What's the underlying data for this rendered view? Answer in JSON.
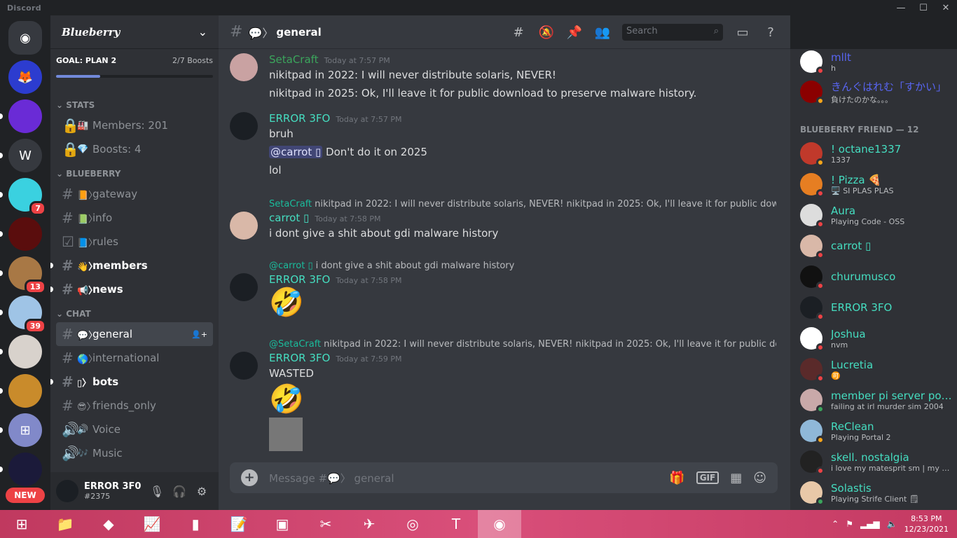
{
  "window": {
    "title": "Discord",
    "controls": [
      "—",
      "☐",
      "✕"
    ]
  },
  "guilds": {
    "items": [
      {
        "name": "home",
        "color": "#36393f",
        "glyph": "◉",
        "badge": ""
      },
      {
        "name": "firefox-server",
        "color": "#2c3ccf",
        "glyph": "🦊",
        "badge": ""
      },
      {
        "name": "purple-server",
        "color": "#6a2bd6",
        "glyph": "",
        "badge": ""
      },
      {
        "name": "w-server",
        "color": "#36393f",
        "glyph": "W",
        "badge": ""
      },
      {
        "name": "cloud-server",
        "color": "#3ad1e0",
        "glyph": "",
        "badge": "7"
      },
      {
        "name": "red-server",
        "color": "#5a0d0d",
        "glyph": "",
        "badge": ""
      },
      {
        "name": "dog-server",
        "color": "#a87845",
        "glyph": "",
        "badge": "13"
      },
      {
        "name": "anime-server",
        "color": "#9fc4e6",
        "glyph": "",
        "badge": "39"
      },
      {
        "name": "cat-server",
        "color": "#d8d2cc",
        "glyph": "",
        "badge": ""
      },
      {
        "name": "doge-server",
        "color": "#c98b2b",
        "glyph": "",
        "badge": ""
      },
      {
        "name": "windows-server",
        "color": "#8189c9",
        "glyph": "⊞",
        "badge": ""
      },
      {
        "name": "dark-server",
        "color": "#1b1a3a",
        "glyph": "",
        "badge": ""
      }
    ],
    "new_label": "NEW"
  },
  "server": {
    "name": "Blueberry",
    "goal": {
      "label": "GOAL: PLAN 2",
      "boosts": "2/7 Boosts",
      "progress": 0.28
    },
    "categories": [
      {
        "name": "STATS",
        "channels": [
          {
            "icon": "🔒",
            "emoji": "🏭",
            "label": "Members: 201",
            "state": "muted"
          },
          {
            "icon": "🔒",
            "emoji": "💎",
            "label": "Boosts: 4",
            "state": "muted"
          }
        ]
      },
      {
        "name": "BLUEBERRY",
        "channels": [
          {
            "icon": "#",
            "emoji": "📙〉",
            "label": "gateway",
            "state": "muted"
          },
          {
            "icon": "#",
            "emoji": "📗〉",
            "label": "info",
            "state": "muted"
          },
          {
            "icon": "☑",
            "emoji": "📘〉",
            "label": "rules",
            "state": "muted"
          },
          {
            "icon": "#",
            "emoji": "👋〉",
            "label": "members",
            "state": "unread"
          },
          {
            "icon": "#",
            "emoji": "📢〉",
            "label": "news",
            "state": "unread"
          }
        ]
      },
      {
        "name": "CHAT",
        "channels": [
          {
            "icon": "#",
            "emoji": "💬〉",
            "label": "general",
            "state": "active"
          },
          {
            "icon": "#",
            "emoji": "🌎〉",
            "label": "international",
            "state": "muted"
          },
          {
            "icon": "#",
            "emoji": "▯〉",
            "label": "bots",
            "state": "unread"
          },
          {
            "icon": "#",
            "emoji": "😎〉",
            "label": "friends_only",
            "state": "muted"
          },
          {
            "icon": "🔊",
            "emoji": "🔊",
            "label": "Voice",
            "state": "muted"
          },
          {
            "icon": "🔊",
            "emoji": "🎶",
            "label": "Music",
            "state": "muted"
          }
        ]
      }
    ]
  },
  "user": {
    "name": "ERROR 3F0",
    "tag": "#2375"
  },
  "channel": {
    "name": "general",
    "prefix": "💬〉",
    "search_placeholder": "Search"
  },
  "messages": [
    {
      "author": "SetaCraft",
      "author_color": "#3ba55c",
      "time": "Today at 7:57 PM",
      "lines": [
        "nikitpad in 2022: I will never distribute solaris, NEVER!",
        "nikitpad in 2025: Ok, I'll leave it for public download to preserve malware history."
      ]
    },
    {
      "author": "ERROR 3FO",
      "author_color": "#45ddc0",
      "time": "Today at 7:57 PM",
      "lines": [
        "bruh"
      ],
      "mention": "@carrot ▯",
      "mention_text": " Don't do it on 2025",
      "lines2": [
        "lol"
      ]
    },
    {
      "reply_author": "SetaCraft",
      "reply_text": "nikitpad in 2022: I will never distribute solaris, NEVER! nikitpad in 2025: Ok, I'll leave it for public dow...",
      "author": "carrot ▯",
      "author_color": "#45ddc0",
      "time": "Today at 7:58 PM",
      "lines": [
        "i dont give a shit about gdi malware history"
      ]
    },
    {
      "reply_author": "@carrot ▯",
      "reply_text": "i dont give a shit about gdi malware history",
      "author": "ERROR 3FO",
      "author_color": "#45ddc0",
      "time": "Today at 7:58 PM",
      "emoji": "🤣"
    },
    {
      "reply_author": "@SetaCraft",
      "reply_text": "nikitpad in 2022: I will never distribute solaris, NEVER! nikitpad in 2025: Ok, I'll leave it for public do...",
      "author": "ERROR 3FO",
      "author_color": "#45ddc0",
      "time": "Today at 7:59 PM",
      "lines": [
        "WASTED"
      ],
      "emoji": "🤣"
    }
  ],
  "composer": {
    "placeholder": "Message #💬〉 general",
    "gif_label": "GIF"
  },
  "members": {
    "top": [
      {
        "name": "mllt",
        "sub": "h",
        "color": "#5865f2",
        "status": "#ed4245",
        "avatar": "#ffffff"
      },
      {
        "name": "きんぐはれむ「すかい」",
        "sub": "負けたのかな。。。",
        "color": "#5865f2",
        "status": "#faa61a",
        "avatar": "#8b0000"
      }
    ],
    "group": "BLUEBERRY FRIEND — 12",
    "list": [
      {
        "name": "! octane1337",
        "sub": "1337",
        "color": "#45ddc0",
        "status": "#faa61a",
        "avatar": "#c0392b"
      },
      {
        "name": "! Pizza 🍕",
        "sub": "🖥️ SI PLAS PLAS",
        "color": "#45ddc0",
        "status": "#ed4245",
        "avatar": "#e67e22"
      },
      {
        "name": "Aura",
        "sub": "Playing Code - OSS",
        "color": "#45ddc0",
        "status": "#ed4245",
        "avatar": "#dddddd"
      },
      {
        "name": "carrot ▯",
        "sub": "",
        "color": "#45ddc0",
        "status": "#ed4245",
        "avatar": "#d9b8a8"
      },
      {
        "name": "churumusco",
        "sub": "",
        "color": "#45ddc0",
        "status": "#ed4245",
        "avatar": "#111111"
      },
      {
        "name": "ERROR 3FO",
        "sub": "",
        "color": "#45ddc0",
        "status": "#ed4245",
        "avatar": "#1b1f24"
      },
      {
        "name": "Joshua",
        "sub": "nvm",
        "color": "#45ddc0",
        "status": "#ed4245",
        "avatar": "#ffffff"
      },
      {
        "name": "Lucretia",
        "sub": "🉑",
        "color": "#45ddc0",
        "status": "#ed4245",
        "avatar": "#5a2a2a"
      },
      {
        "name": "member pi server pon...",
        "sub": "failing at irl murder sim 2004",
        "color": "#45ddc0",
        "status": "#3ba55c",
        "avatar": "#c9a9a9"
      },
      {
        "name": "ReClean",
        "sub": "Playing Portal 2",
        "color": "#45ddc0",
        "status": "#faa61a",
        "avatar": "#8fb8d8"
      },
      {
        "name": "skell. nostalgia",
        "sub": "i love my matesprit sm | my m...",
        "color": "#45ddc0",
        "status": "#ed4245",
        "avatar": "#222222"
      },
      {
        "name": "Solastis",
        "sub": "Playing Strife Client 🗒",
        "color": "#45ddc0",
        "status": "#3ba55c",
        "avatar": "#e8c8a8"
      }
    ]
  },
  "taskbar": {
    "time": "8:53 PM",
    "date": "12/23/2021"
  }
}
